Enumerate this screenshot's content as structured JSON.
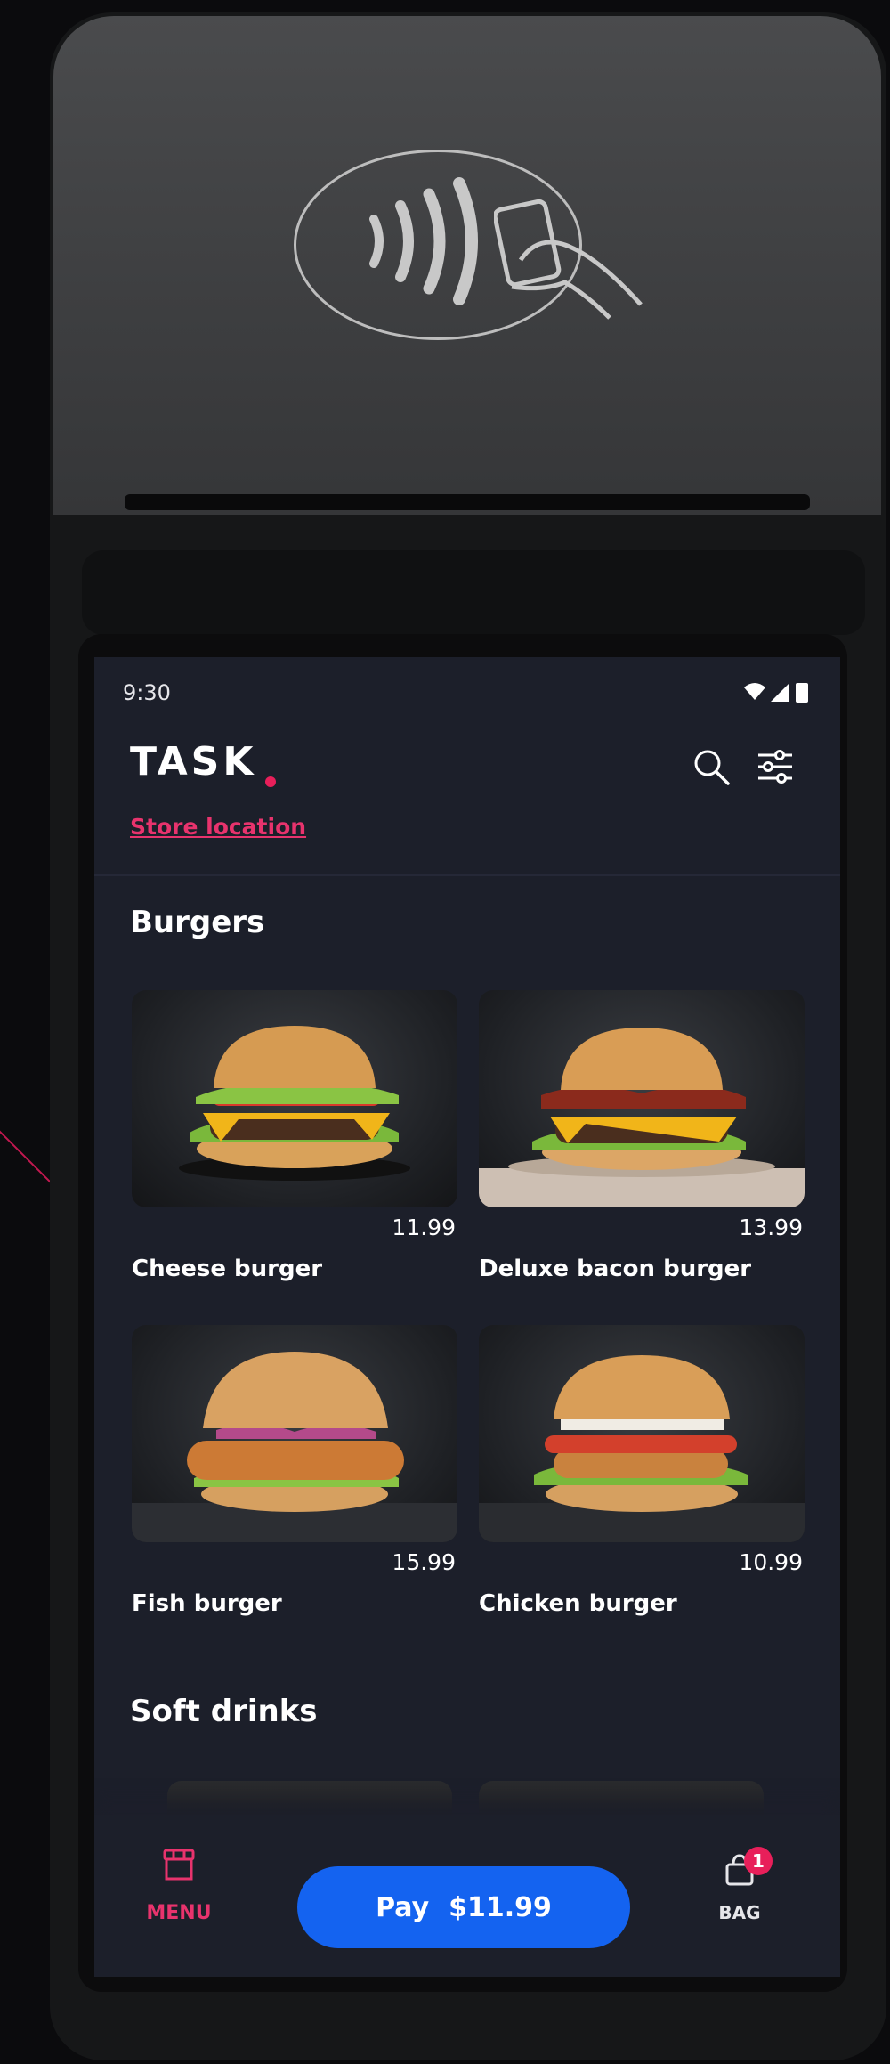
{
  "status_bar": {
    "time": "9:30",
    "icons": [
      "wifi-icon",
      "signal-icon",
      "battery-icon"
    ]
  },
  "header": {
    "logo_text": "TASK",
    "store_link": "Store location",
    "icons": [
      "search-icon",
      "filter-icon"
    ]
  },
  "sections": [
    {
      "title": "Burgers",
      "items": [
        {
          "name": "Cheese burger",
          "price": "11.99"
        },
        {
          "name": "Deluxe bacon burger",
          "price": "13.99"
        },
        {
          "name": "Fish burger",
          "price": "15.99"
        },
        {
          "name": "Chicken burger",
          "price": "10.99"
        }
      ]
    },
    {
      "title": "Soft drinks",
      "items": []
    }
  ],
  "bottom_nav": {
    "menu_label": "MENU",
    "pay_label": "Pay",
    "pay_amount": "$11.99",
    "bag_label": "BAG",
    "bag_count": "1"
  },
  "colors": {
    "accent": "#e8336d",
    "pay_button": "#1463f0",
    "screen_bg": "#1c1f2a"
  }
}
